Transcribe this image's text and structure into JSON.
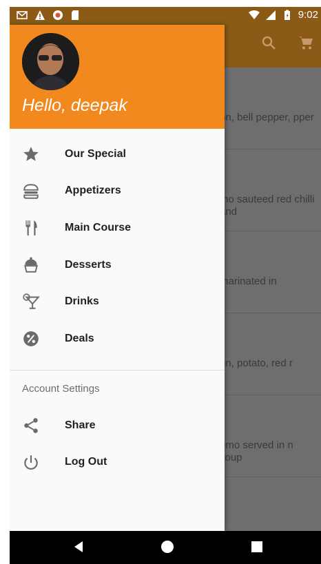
{
  "status_bar": {
    "time": "9:02",
    "left_icons": [
      "gmail-icon",
      "warning-icon",
      "record-icon",
      "sd-card-icon"
    ],
    "right_icons": [
      "wifi-icon",
      "signal-icon",
      "battery-icon"
    ]
  },
  "toolbar": {
    "icons": [
      "search-icon",
      "cart-icon"
    ]
  },
  "background_list": [
    {
      "snippet": "on, bell pepper, pper"
    },
    {
      "snippet": "mo sauteed red chilli and"
    },
    {
      "snippet": "marinated in"
    },
    {
      "snippet": "on, potato, red r"
    },
    {
      "snippet": "omo served in n soup"
    }
  ],
  "drawer": {
    "header_color": "#f2891e",
    "greeting": "Hello, deepak",
    "menu": [
      {
        "label": "Our Special",
        "icon": "star-icon"
      },
      {
        "label": "Appetizers",
        "icon": "burger-icon"
      },
      {
        "label": "Main Course",
        "icon": "cutlery-icon"
      },
      {
        "label": "Desserts",
        "icon": "cupcake-icon"
      },
      {
        "label": "Drinks",
        "icon": "cocktail-icon"
      },
      {
        "label": "Deals",
        "icon": "percent-badge-icon"
      }
    ],
    "section_title": "Account Settings",
    "account_menu": [
      {
        "label": "Share",
        "icon": "share-icon"
      },
      {
        "label": "Log Out",
        "icon": "power-icon"
      }
    ]
  },
  "nav_bar": {
    "buttons": [
      "back-button",
      "home-button",
      "recents-button"
    ]
  }
}
